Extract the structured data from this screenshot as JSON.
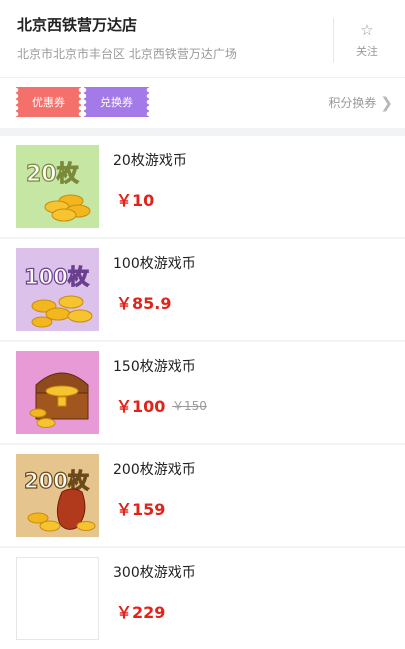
{
  "store": {
    "name": "北京西铁营万达店",
    "address": "北京市北京市丰台区 北京西铁营万达广场",
    "follow_label": "关注"
  },
  "coupons": {
    "items": [
      {
        "label": "优惠券",
        "color": "#f4716b"
      },
      {
        "label": "兑换券",
        "color": "#a37ae8"
      }
    ],
    "points_link": "积分换券"
  },
  "products": [
    {
      "title": "20枚游戏币",
      "price": "￥10",
      "old_price": "",
      "thumb_label": "20枚",
      "thumb_bg": "#c6e6a3"
    },
    {
      "title": "100枚游戏币",
      "price": "￥85.9",
      "old_price": "",
      "thumb_label": "100枚",
      "thumb_bg": "#dcc2ea"
    },
    {
      "title": "150枚游戏币",
      "price": "￥100",
      "old_price": "￥150",
      "thumb_label": "",
      "thumb_bg": "#e79ad6"
    },
    {
      "title": "200枚游戏币",
      "price": "￥159",
      "old_price": "",
      "thumb_label": "200枚",
      "thumb_bg": "#e6c48d"
    },
    {
      "title": "300枚游戏币",
      "price": "￥229",
      "old_price": "",
      "thumb_label": "",
      "thumb_bg": "#ffffff"
    }
  ],
  "colors": {
    "price": "#e2231a",
    "muted": "#9a9a9a",
    "page_bg": "#f2f3f5"
  }
}
